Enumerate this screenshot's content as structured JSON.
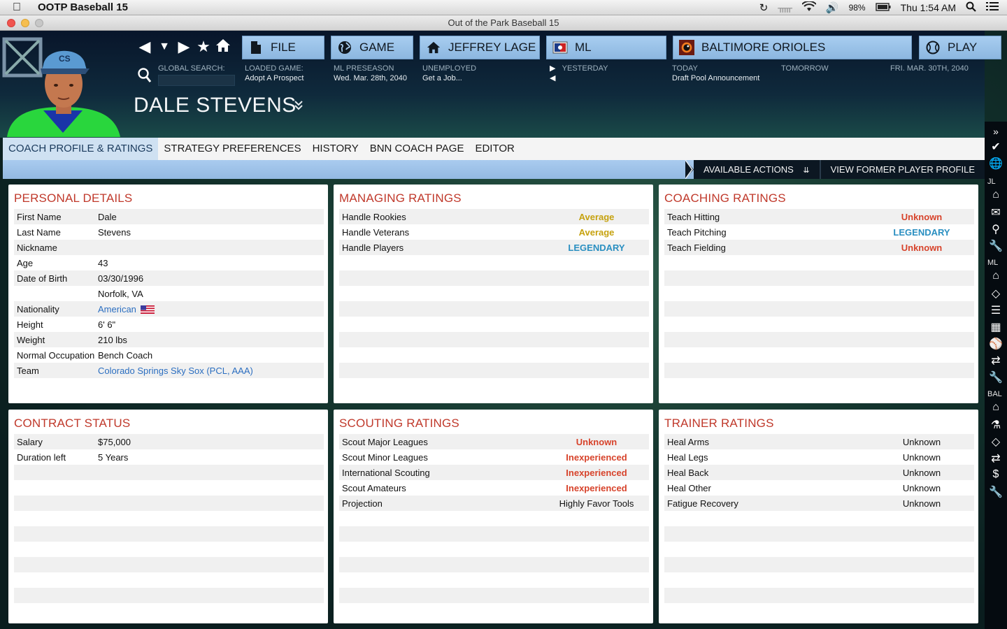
{
  "menubar": {
    "app_name": "OOTP Baseball 15",
    "battery": "98%",
    "clock": "Thu 1:54 AM"
  },
  "window": {
    "title": "Out of the Park Baseball 15"
  },
  "topbar": {
    "file_label": "FILE",
    "game_label": "GAME",
    "manager_label": "JEFFREY LAGE",
    "league_label": "ML",
    "team_label": "BALTIMORE ORIOLES",
    "play_label": "PLAY",
    "global_search_label": "GLOBAL SEARCH:",
    "loaded_game_label": "LOADED GAME:",
    "loaded_game_value": "Adopt A Prospect",
    "season_label": "ML PRESEASON",
    "season_date": "Wed. Mar. 28th, 2040",
    "status_label": "UNEMPLOYED",
    "status_value": "Get a Job...",
    "yesterday_label": "YESTERDAY",
    "today_label": "TODAY",
    "today_value": "Draft Pool Announcement",
    "tomorrow_label": "TOMORROW",
    "next_date": "FRI. MAR. 30TH, 2040"
  },
  "player": {
    "name": "DALE STEVENS"
  },
  "tabs": [
    {
      "label": "COACH PROFILE & RATINGS"
    },
    {
      "label": "STRATEGY PREFERENCES"
    },
    {
      "label": "HISTORY"
    },
    {
      "label": "BNN COACH PAGE"
    },
    {
      "label": "EDITOR"
    }
  ],
  "actions": {
    "available": "AVAILABLE ACTIONS",
    "former_profile": "VIEW FORMER PLAYER PROFILE"
  },
  "personal": {
    "title": "PERSONAL DETAILS",
    "rows": [
      {
        "label": "First Name",
        "value": "Dale"
      },
      {
        "label": "Last Name",
        "value": "Stevens"
      },
      {
        "label": "Nickname",
        "value": ""
      },
      {
        "label": "Age",
        "value": "43"
      },
      {
        "label": "Date of Birth",
        "value": "03/30/1996"
      },
      {
        "label": "",
        "value": "Norfolk, VA"
      },
      {
        "label": "Nationality",
        "value": "American"
      },
      {
        "label": "Height",
        "value": "6' 6\""
      },
      {
        "label": "Weight",
        "value": "210 lbs"
      },
      {
        "label": "Normal Occupation",
        "value": "Bench Coach"
      },
      {
        "label": "Team",
        "value": "Colorado Springs Sky Sox (PCL, AAA)"
      }
    ]
  },
  "managing": {
    "title": "MANAGING RATINGS",
    "rows": [
      {
        "label": "Handle Rookies",
        "value": "Average"
      },
      {
        "label": "Handle Veterans",
        "value": "Average"
      },
      {
        "label": "Handle Players",
        "value": "LEGENDARY"
      }
    ]
  },
  "coaching": {
    "title": "COACHING RATINGS",
    "rows": [
      {
        "label": "Teach Hitting",
        "value": "Unknown"
      },
      {
        "label": "Teach Pitching",
        "value": "LEGENDARY"
      },
      {
        "label": "Teach Fielding",
        "value": "Unknown"
      }
    ]
  },
  "contract": {
    "title": "CONTRACT STATUS",
    "rows": [
      {
        "label": "Salary",
        "value": "$75,000"
      },
      {
        "label": "Duration left",
        "value": "5 Years"
      }
    ]
  },
  "scouting": {
    "title": "SCOUTING RATINGS",
    "rows": [
      {
        "label": "Scout Major Leagues",
        "value": "Unknown"
      },
      {
        "label": "Scout Minor Leagues",
        "value": "Inexperienced"
      },
      {
        "label": "International Scouting",
        "value": "Inexperienced"
      },
      {
        "label": "Scout Amateurs",
        "value": "Inexperienced"
      },
      {
        "label": "Projection",
        "value": "Highly Favor Tools"
      }
    ]
  },
  "trainer": {
    "title": "TRAINER RATINGS",
    "rows": [
      {
        "label": "Heal Arms",
        "value": "Unknown"
      },
      {
        "label": "Heal Legs",
        "value": "Unknown"
      },
      {
        "label": "Heal Back",
        "value": "Unknown"
      },
      {
        "label": "Heal Other",
        "value": "Unknown"
      },
      {
        "label": "Fatigue Recovery",
        "value": "Unknown"
      }
    ]
  },
  "sidebar": {
    "jl": "JL",
    "ml": "ML",
    "bal": "BAL"
  },
  "colors": {
    "accent_blue": "#8cb7e0",
    "title_red": "#c0392b",
    "legendary": "#2a8fc1",
    "average": "#c6a20f",
    "unknown": "#d7432b"
  }
}
